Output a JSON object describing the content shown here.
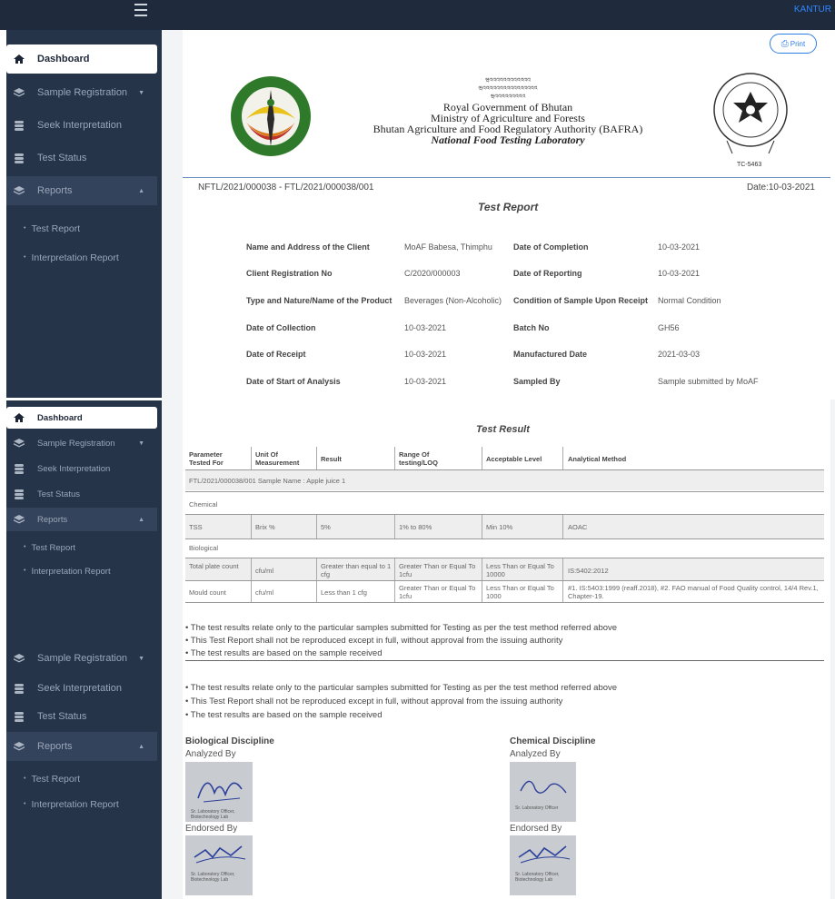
{
  "topbar": {
    "user": "KANTUR"
  },
  "sidebar": {
    "items": [
      {
        "label": "Dashboard",
        "icon": "home-icon"
      },
      {
        "label": "Sample Registration",
        "icon": "layers-icon"
      },
      {
        "label": "Seek Interpretation",
        "icon": "database-icon"
      },
      {
        "label": "Test Status",
        "icon": "database-icon"
      },
      {
        "label": "Reports",
        "icon": "layers-icon"
      }
    ],
    "subitems": [
      "Test Report",
      "Interpretation Report"
    ]
  },
  "toolbar": {
    "print_label": "Print"
  },
  "header": {
    "dz_line1": "ཝའའའའའའའའའའའའ",
    "dz_line2": "ཝའའའའའའའའའའའའའའའའ",
    "dz_line3": "ཝའའའའའའའའའ",
    "line1": "Royal Government of Bhutan",
    "line2": "Ministry of Agriculture and Forests",
    "line3": "Bhutan Agriculture and Food Regulatory Authority (BAFRA)",
    "line4": "National Food Testing Laboratory",
    "cert_code": "TC-5463"
  },
  "report": {
    "ref": "NFTL/2021/000038 - FTL/2021/000038/001",
    "date": "Date:10-03-2021",
    "title": "Test Report",
    "fields": [
      {
        "k": "Name and Address of the Client",
        "v": "MoAF Babesa, Thimphu",
        "k2": "Date of Completion",
        "v2": "10-03-2021"
      },
      {
        "k": "Client Registration No",
        "v": "C/2020/000003",
        "k2": "Date of Reporting",
        "v2": "10-03-2021"
      },
      {
        "k": "Type and Nature/Name of the Product",
        "v": "Beverages (Non-Alcoholic)",
        "k2": "Condition of Sample Upon Receipt",
        "v2": "Normal Condition"
      },
      {
        "k": "Date of Collection",
        "v": "10-03-2021",
        "k2": "Batch No",
        "v2": "GH56"
      },
      {
        "k": "Date of Receipt",
        "v": "10-03-2021",
        "k2": "Manufactured Date",
        "v2": "2021-03-03"
      },
      {
        "k": "Date of Start of Analysis",
        "v": "10-03-2021",
        "k2": "Sampled By",
        "v2": "Sample submitted by  MoAF"
      }
    ]
  },
  "results": {
    "title": "Test Result",
    "headers": [
      "Parameter Tested For",
      "Unit Of Measurement",
      "Result",
      "Range Of testing/LOQ",
      "Acceptable Level",
      "Analytical Method"
    ],
    "sample_row": "FTL/2021/000038/001   Sample Name : Apple juice 1",
    "group_chemical": "Chemical",
    "group_biological": "Biological",
    "rows": [
      [
        "TSS",
        "Brix %",
        "5%",
        "1% to 80%",
        "Min 10%",
        "AOAC"
      ],
      [
        "Total plate count",
        "cfu/ml",
        "Greater than equal to 1 cfg",
        "Greater Than or Equal To 1cfu",
        "Less Than or Equal To 10000",
        "IS:5402:2012"
      ],
      [
        "Mould count",
        "cfu/ml",
        "Less than 1 cfg",
        "Greater Than or Equal To 1cfu",
        "Less Than or Equal To 1000",
        "#1. IS:5403:1999 (reaff.2018), #2. FAO manual of Food Quality control, 14/4 Rev.1, Chapter-19."
      ]
    ]
  },
  "notes": [
    "• The test results relate only to the particular samples submitted for Testing as per the test method referred above",
    "• This Test Report shall not be reproduced except in full, without approval from the issuing authority",
    "• The test results are based on the sample received"
  ],
  "signatures": {
    "bio_title": "Biological Discipline",
    "chem_title": "Chemical Discipline",
    "analyzed": "Analyzed By",
    "endorsed": "Endorsed By",
    "bio_analyst": "Sr. Laboratory Officer, Biotechnology Lab",
    "chem_analyst": "Sr. Laboratory Officer",
    "endorser": "Sr. Laboratory Officer, Biotechnology Lab"
  }
}
